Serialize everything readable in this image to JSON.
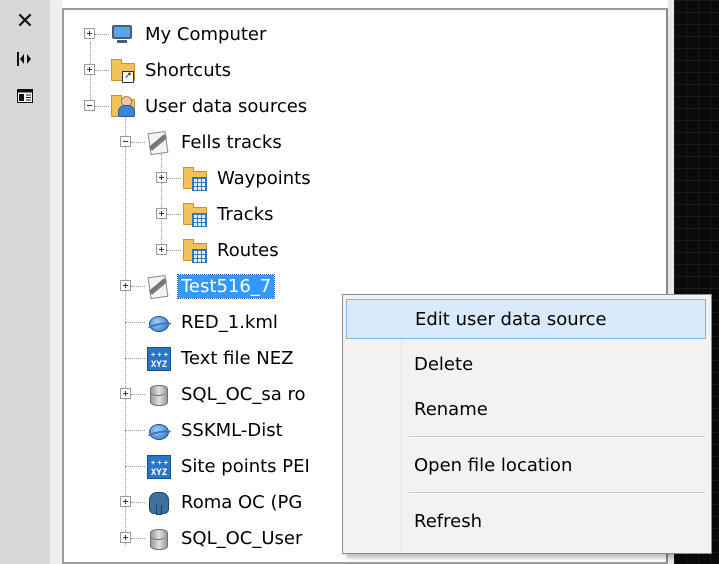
{
  "toolbar": {
    "close_glyph": "✕",
    "dock_glyph": "|◂▸",
    "panel_icon": "panel-toggle-icon"
  },
  "tree": {
    "items": [
      {
        "label": "My Computer",
        "icon": "monitor-icon",
        "expander": "plus"
      },
      {
        "label": "Shortcuts",
        "icon": "folder-shortcut-icon",
        "expander": "plus"
      },
      {
        "label": "User data sources",
        "icon": "user-folder-icon",
        "expander": "minus"
      },
      {
        "label": "Fells tracks",
        "icon": "pencil-document-icon",
        "expander": "minus"
      },
      {
        "label": "Waypoints",
        "icon": "folder-table-icon",
        "expander": "plus"
      },
      {
        "label": "Tracks",
        "icon": "folder-table-icon",
        "expander": "plus"
      },
      {
        "label": "Routes",
        "icon": "folder-table-icon",
        "expander": "plus"
      },
      {
        "label": "Test516_7",
        "icon": "pencil-document-icon",
        "expander": "plus",
        "selected": true
      },
      {
        "label": "RED_1.kml",
        "icon": "kml-globe-icon",
        "expander": "none"
      },
      {
        "label": "Text file NEZ",
        "icon": "xyz-file-icon",
        "expander": "none"
      },
      {
        "label": "SQL_OC_sa ro",
        "icon": "database-icon",
        "expander": "plus"
      },
      {
        "label": "SSKML-Dist",
        "icon": "kml-globe-icon",
        "expander": "none"
      },
      {
        "label": "Site points PEI",
        "icon": "xyz-file-icon",
        "expander": "none"
      },
      {
        "label": "Roma OC (PG",
        "icon": "postgres-icon",
        "expander": "plus"
      },
      {
        "label": "SQL_OC_User",
        "icon": "database-icon",
        "expander": "plus"
      }
    ]
  },
  "xyz_text": "XYZ",
  "context_menu": {
    "items": [
      {
        "label": "Edit user data source",
        "highlighted": true
      },
      {
        "label": "Delete"
      },
      {
        "label": "Rename"
      },
      {
        "label": "Open file location"
      },
      {
        "label": "Refresh"
      }
    ]
  }
}
